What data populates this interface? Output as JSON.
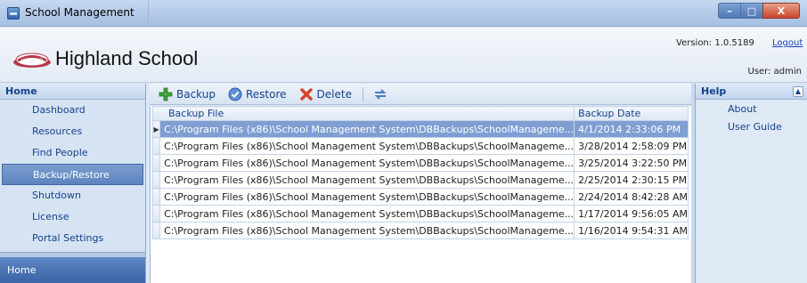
{
  "window": {
    "title": "School Management",
    "buttons": [
      "–",
      "□",
      "X"
    ]
  },
  "header": {
    "school_name": "Highland School",
    "logo_text": "HIGHLAND",
    "version": "Version: 1.0.5189",
    "logout": "Logout",
    "user": "User: admin"
  },
  "sidebar": {
    "heading": "Home",
    "items": [
      {
        "label": "Dashboard"
      },
      {
        "label": "Resources"
      },
      {
        "label": "Find People"
      },
      {
        "label": "Backup/Restore",
        "active": true
      },
      {
        "label": "Shutdown"
      },
      {
        "label": "License"
      },
      {
        "label": "Portal Settings"
      }
    ],
    "bottom_tab": "Home"
  },
  "toolbar": {
    "backup": "Backup",
    "restore": "Restore",
    "delete": "Delete",
    "icons": [
      "add-icon",
      "check-icon",
      "delete-x-icon",
      "refresh-icon"
    ]
  },
  "grid": {
    "columns": [
      "Backup File",
      "Backup Date"
    ],
    "rows": [
      {
        "file": "C:\\Program Files (x86)\\School Management System\\DBBackups\\SchoolManageme...",
        "date": "4/1/2014 2:33:06 PM",
        "selected": true
      },
      {
        "file": "C:\\Program Files (x86)\\School Management System\\DBBackups\\SchoolManageme...",
        "date": "3/28/2014 2:58:09 PM"
      },
      {
        "file": "C:\\Program Files (x86)\\School Management System\\DBBackups\\SchoolManageme...",
        "date": "3/25/2014 3:22:50 PM"
      },
      {
        "file": "C:\\Program Files (x86)\\School Management System\\DBBackups\\SchoolManageme...",
        "date": "2/25/2014 2:30:15 PM"
      },
      {
        "file": "C:\\Program Files (x86)\\School Management System\\DBBackups\\SchoolManageme...",
        "date": "2/24/2014 8:42:28 AM"
      },
      {
        "file": "C:\\Program Files (x86)\\School Management System\\DBBackups\\SchoolManageme...",
        "date": "1/17/2014 9:56:05 AM"
      },
      {
        "file": "C:\\Program Files (x86)\\School Management System\\DBBackups\\SchoolManageme...",
        "date": "1/16/2014 9:54:31 AM"
      }
    ]
  },
  "help": {
    "heading": "Help",
    "items": [
      {
        "label": "About"
      },
      {
        "label": "User Guide"
      }
    ]
  },
  "colors": {
    "accent": "#15428b",
    "selected_row": "#7f9fd3",
    "nav_active": "#5d84c0"
  }
}
